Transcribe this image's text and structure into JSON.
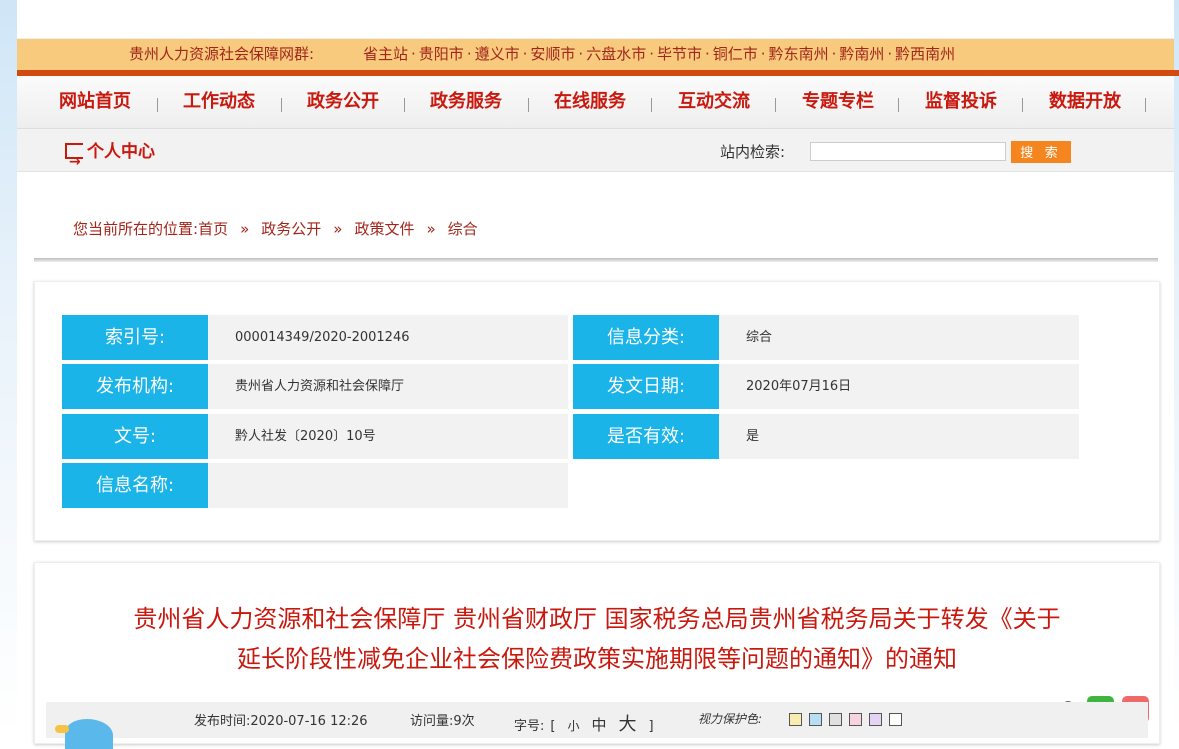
{
  "site_group": {
    "title": "贵州人力资源社会保障网群:",
    "links": [
      "省主站",
      "贵阳市",
      "遵义市",
      "安顺市",
      "六盘水市",
      "毕节市",
      "铜仁市",
      "黔东南州",
      "黔南州",
      "黔西南州"
    ],
    "separator": "·"
  },
  "nav": {
    "items": [
      "网站首页",
      "工作动态",
      "政务公开",
      "政务服务",
      "在线服务",
      "互动交流",
      "专题专栏",
      "监督投诉",
      "数据开放"
    ]
  },
  "subbar": {
    "personal_center": "个人中心",
    "search_label": "站内检索:",
    "search_value": "",
    "search_button": "搜 索"
  },
  "breadcrumb": {
    "prefix": "您当前所在的位置:",
    "items": [
      "首页",
      "政务公开",
      "政策文件",
      "综合"
    ],
    "arrow": "»"
  },
  "info": {
    "index_label": "索引号:",
    "index_value": "000014349/2020-2001246",
    "category_label": "信息分类:",
    "category_value": "综合",
    "publisher_label": "发布机构:",
    "publisher_value": "贵州省人力资源和社会保障厅",
    "date_label": "发文日期:",
    "date_value": "2020年07月16日",
    "docno_label": "文号:",
    "docno_value": "黔人社发〔2020〕10号",
    "valid_label": "是否有效:",
    "valid_value": "是",
    "name_label": "信息名称:",
    "name_value": ""
  },
  "article": {
    "title_line1": "贵州省人力资源和社会保障厅 贵州省财政厅 国家税务总局贵州省税务局关于转发《关于",
    "title_line2": "延长阶段性减免企业社会保险费政策实施期限等问题的通知》的通知",
    "publish_label": "发布时间:",
    "publish_time": "2020-07-16 12:26",
    "views_label": "访问量:",
    "views": "9次",
    "font_label": "字号:",
    "font_open": "[",
    "font_small": "小",
    "font_medium": "中",
    "font_large": "大",
    "font_close": "]",
    "eye_label": "视力保护色:",
    "eye_colors": [
      "#f8ecb0",
      "#b8def5",
      "#e0e0e0",
      "#f7d4dd",
      "#e3d4f5",
      "#ffffff"
    ]
  },
  "share": {
    "share_icon": "share-icon",
    "wechat_icon": "wechat-icon",
    "weibo_icon": "weibo-icon"
  }
}
